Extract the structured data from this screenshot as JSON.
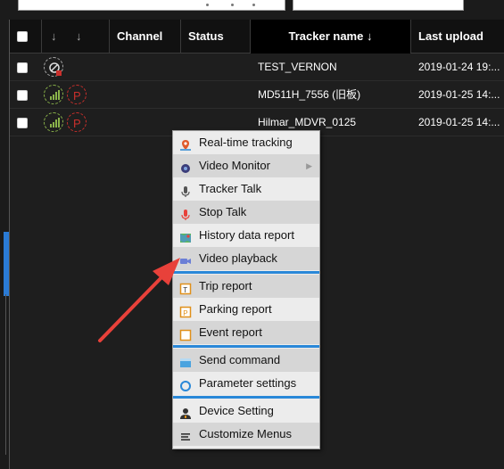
{
  "columns": {
    "sort1": "↓",
    "sort2": "↓",
    "channel": "Channel",
    "status": "Status",
    "tracker_name": "Tracker name ↓",
    "last_upload": "Last upload"
  },
  "rows": [
    {
      "tracker_name": "TEST_VERNON",
      "last_upload": "2019-01-24 19:..."
    },
    {
      "tracker_name": "MD511H_7556 (旧板)",
      "last_upload": "2019-01-25 14:..."
    },
    {
      "tracker_name": "Hilmar_MDVR_0125",
      "last_upload": "2019-01-25 14:..."
    }
  ],
  "menu": {
    "items": [
      {
        "label": "Real-time tracking",
        "icon": "map-pin-icon"
      },
      {
        "label": "Video Monitor",
        "icon": "camera-icon",
        "submenu": "▶"
      },
      {
        "label": "Tracker Talk",
        "icon": "microphone-icon"
      },
      {
        "label": "Stop Talk",
        "icon": "microphone-red-icon"
      },
      {
        "label": "History data report",
        "icon": "map-report-icon"
      },
      {
        "label": "Video playback",
        "icon": "video-camera-icon"
      },
      {
        "label": "Trip report",
        "icon": "trip-report-icon"
      },
      {
        "label": "Parking report",
        "icon": "parking-report-icon"
      },
      {
        "label": "Event report",
        "icon": "event-report-icon"
      },
      {
        "label": "Send command",
        "icon": "command-icon"
      },
      {
        "label": "Parameter settings",
        "icon": "settings-circle-icon"
      },
      {
        "label": "Device Setting",
        "icon": "user-gear-icon"
      },
      {
        "label": "Customize Menus",
        "icon": "menu-list-icon"
      }
    ]
  },
  "colors": {
    "separator": "#2a88d8",
    "annotation_arrow": "#e8413a",
    "signal": "#8ab34a",
    "parking": "#c9302c"
  }
}
